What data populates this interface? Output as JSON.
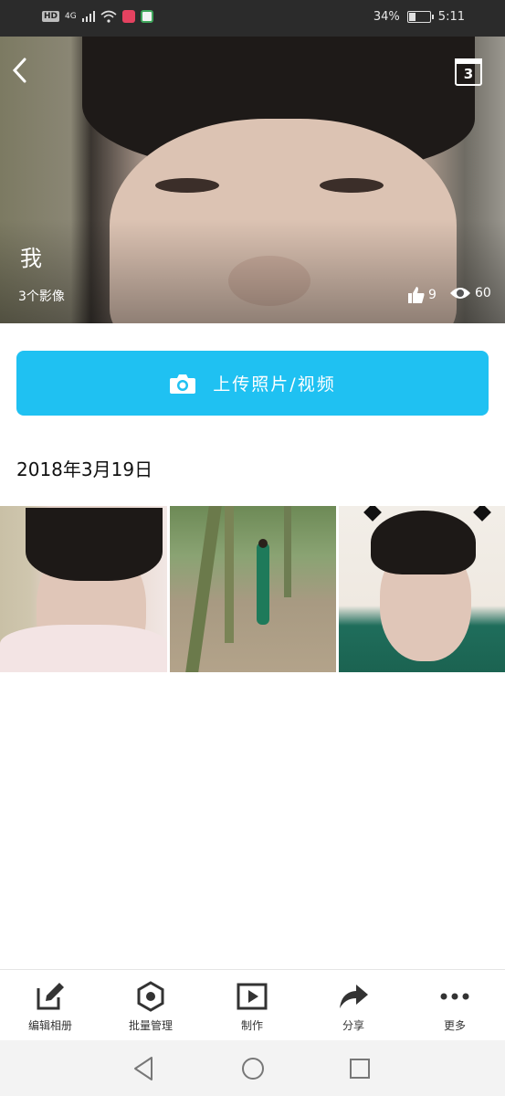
{
  "status_bar": {
    "network": "4G",
    "hd": "HD",
    "battery_text": "34%",
    "battery_level": 0.34,
    "time": "5:11"
  },
  "header": {
    "back_icon": "chevron-left-icon",
    "calendar_icon": "calendar-icon",
    "calendar_day": "3"
  },
  "album": {
    "owner": "我",
    "count_text": "3个影像",
    "likes": "9",
    "views": "60"
  },
  "upload_button": {
    "icon": "camera-icon",
    "label": "上传照片/视频",
    "color": "#1fc1f2"
  },
  "section": {
    "date": "2018年3月19日"
  },
  "photos": [
    "photo-1",
    "photo-2",
    "photo-3"
  ],
  "toolbar": {
    "edit_album": "编辑相册",
    "batch_manage": "批量管理",
    "make": "制作",
    "share": "分享",
    "more": "更多"
  }
}
